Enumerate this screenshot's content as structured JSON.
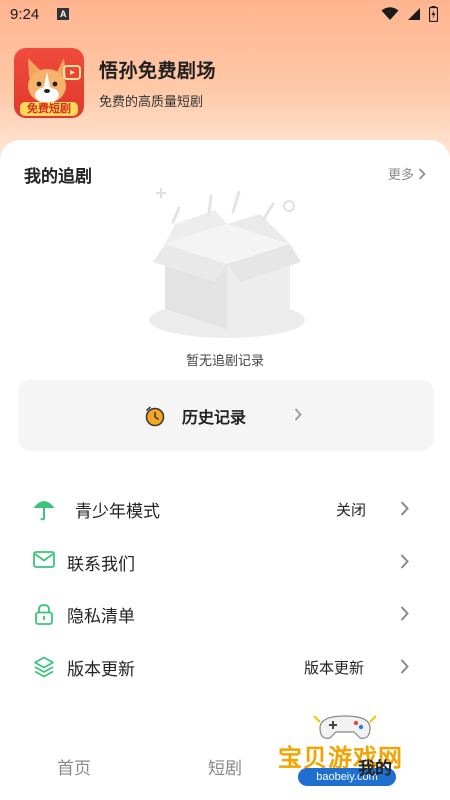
{
  "status_bar": {
    "time": "9:24",
    "a_icon": "A"
  },
  "app": {
    "logo_text": "免费短剧",
    "title": "悟孙免费剧场",
    "subtitle": "免费的高质量短剧"
  },
  "follow": {
    "title": "我的追剧",
    "more_label": "更多",
    "empty_text": "暂无追剧记录"
  },
  "history": {
    "label": "历史记录"
  },
  "menu": [
    {
      "label": "青少年模式",
      "value": "关闭",
      "icon": "umbrella-icon"
    },
    {
      "label": "联系我们",
      "value": "",
      "icon": "mail-icon"
    },
    {
      "label": "隐私清单",
      "value": "",
      "icon": "lock-icon"
    },
    {
      "label": "版本更新",
      "value": "版本更新",
      "icon": "layers-icon"
    }
  ],
  "tabs": [
    {
      "label": "首页"
    },
    {
      "label": "短剧"
    },
    {
      "label": "我的"
    }
  ],
  "watermark": {
    "text": "宝贝游戏网",
    "url": "baobeiy.com"
  },
  "colors": {
    "accent_green": "#3cc47c",
    "history_icon": "#f5a623",
    "header_gradient_top": "#ffb48f"
  }
}
